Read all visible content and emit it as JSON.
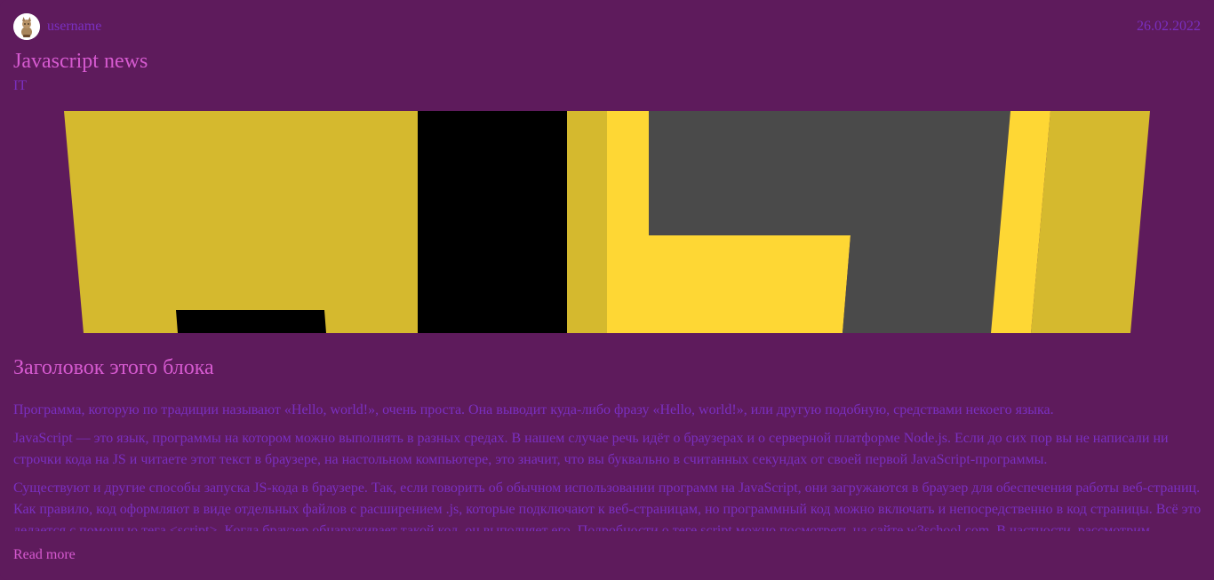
{
  "post": {
    "username": "username",
    "date": "26.02.2022",
    "title": "Javascript news",
    "category": "IT",
    "block_heading": "Заголовок этого блока",
    "paragraphs": [
      "Программа, которую по традиции называют «Hello, world!», очень проста. Она выводит куда-либо фразу «Hello, world!», или другую подобную, средствами некоего языка.",
      "JavaScript — это язык, программы на котором можно выполнять в разных средах. В нашем случае речь идёт о браузерах и о серверной платформе Node.js. Если до сих пор вы не написали ни строчки кода на JS и читаете этот текст в браузере, на настольном компьютере, это значит, что вы буквально в считанных секундах от своей первой JavaScript-программы.",
      "Существуют и другие способы запуска JS-кода в браузере. Так, если говорить об обычном использовании программ на JavaScript, они загружаются в браузер для обеспечения работы веб-страниц. Как правило, код оформляют в виде отдельных файлов с расширением .js, которые подключают к веб-страницам, но программный код можно включать и непосредственно в код страницы. Всё это делается с помощью тега <script>. Когда браузер обнаруживает такой код, он выполняет его. Подробности о теге script можно посмотреть на сайте w3school.com. В частности, рассмотрим"
    ],
    "read_more": "Read more"
  },
  "colors": {
    "background": "#5e1b5c",
    "accent_pink": "#d65ad0",
    "accent_purple": "#7a2fc0",
    "js_yellow": "#d5b92e",
    "js_yellow_bright": "#fed734",
    "js_dark": "#4a4a4a",
    "black": "#000000"
  },
  "icons": {
    "avatar": "cat-avatar-icon"
  }
}
